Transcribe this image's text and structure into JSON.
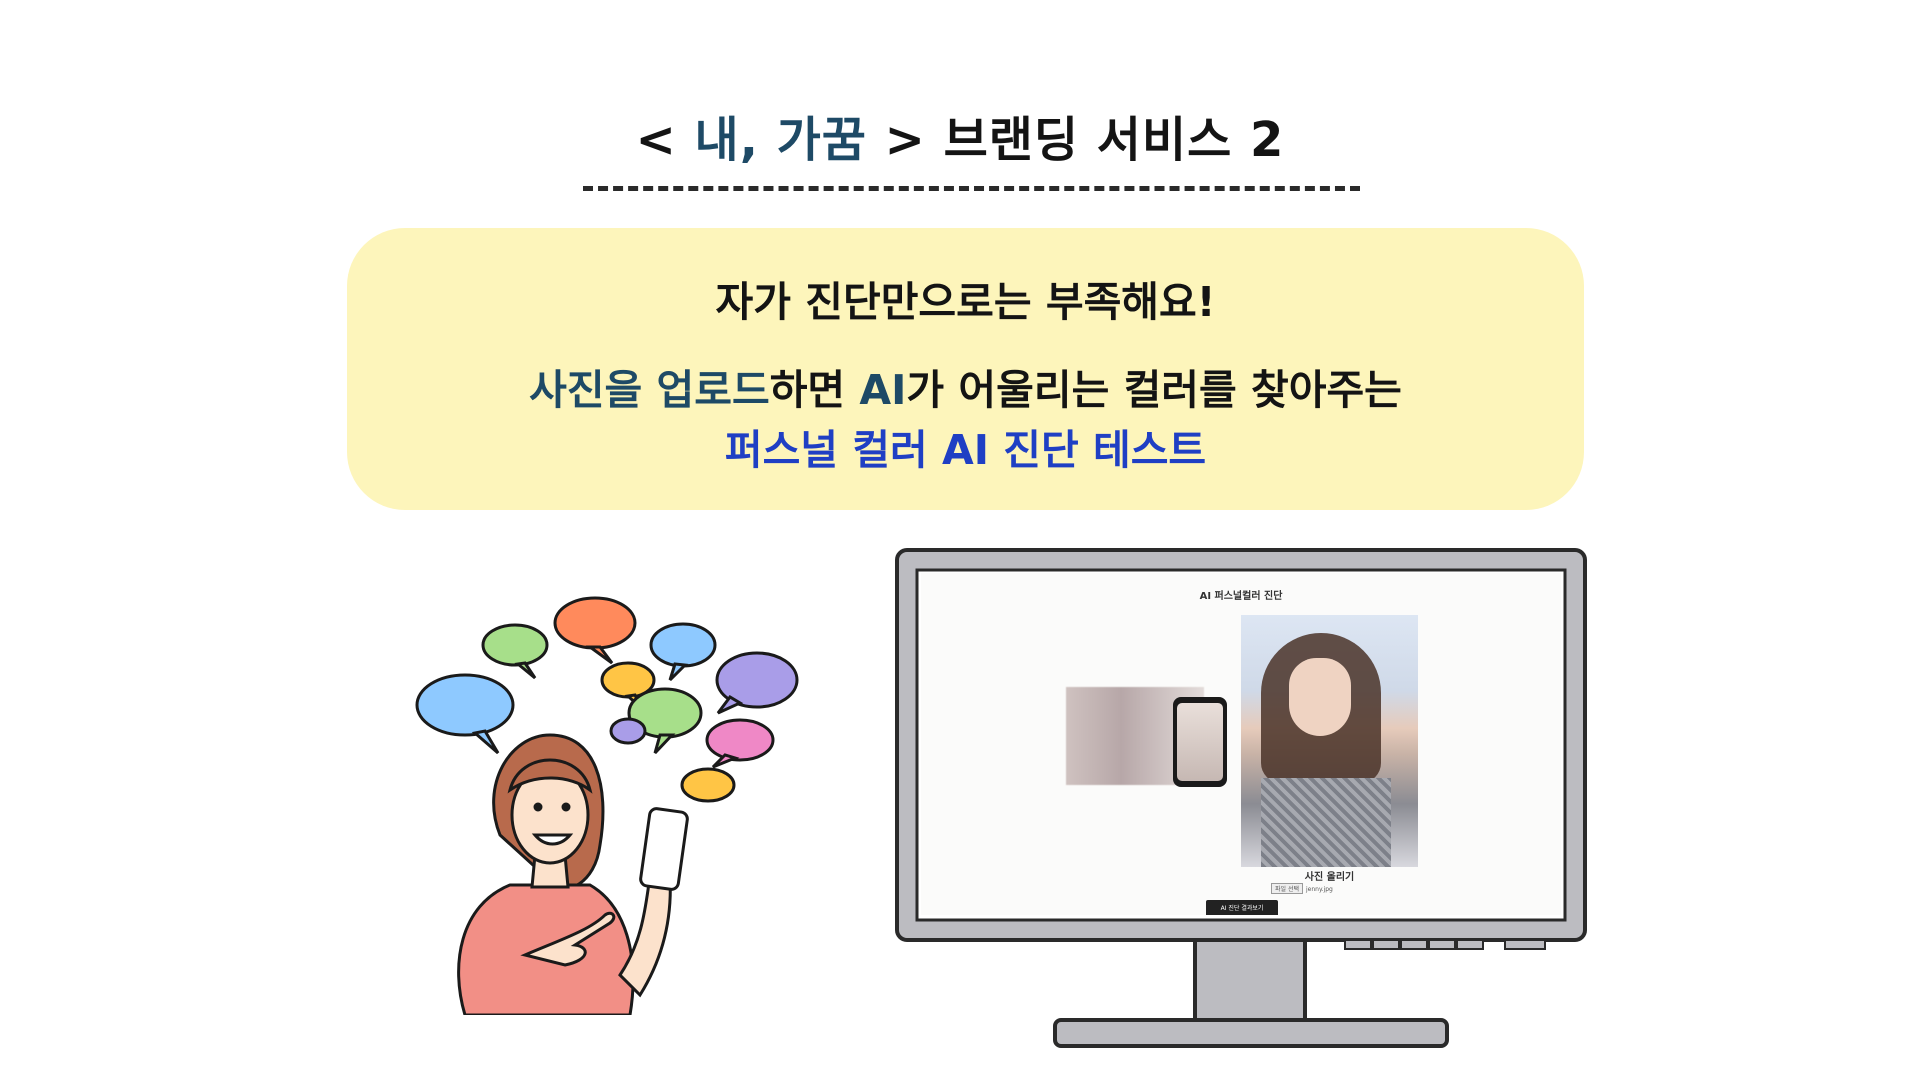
{
  "title": {
    "open": "< ",
    "brand": "내, 가꿈",
    "close": " > 브랜딩 서비스 2"
  },
  "callout": {
    "line1": "자가 진단만으로는 부족해요!",
    "line2_part1": "사진을 업로드",
    "line2_part2": "하면 ",
    "line2_part3": "AI",
    "line2_part4": "가 어울리는 컬러를 찾아주는",
    "line3": "퍼스널 컬러 AI 진단 테스트"
  },
  "screen": {
    "title": "AI 퍼스널컬러 진단",
    "upload_label": "사진 올리기",
    "file_button": "파일 선택",
    "file_name": "jenny.jpg",
    "cta": "AI 진단 결과보기"
  },
  "colors": {
    "accent_dark_teal": "#1e4a66",
    "accent_blue": "#1f3fc4",
    "callout_bg": "#fdf5bb"
  }
}
